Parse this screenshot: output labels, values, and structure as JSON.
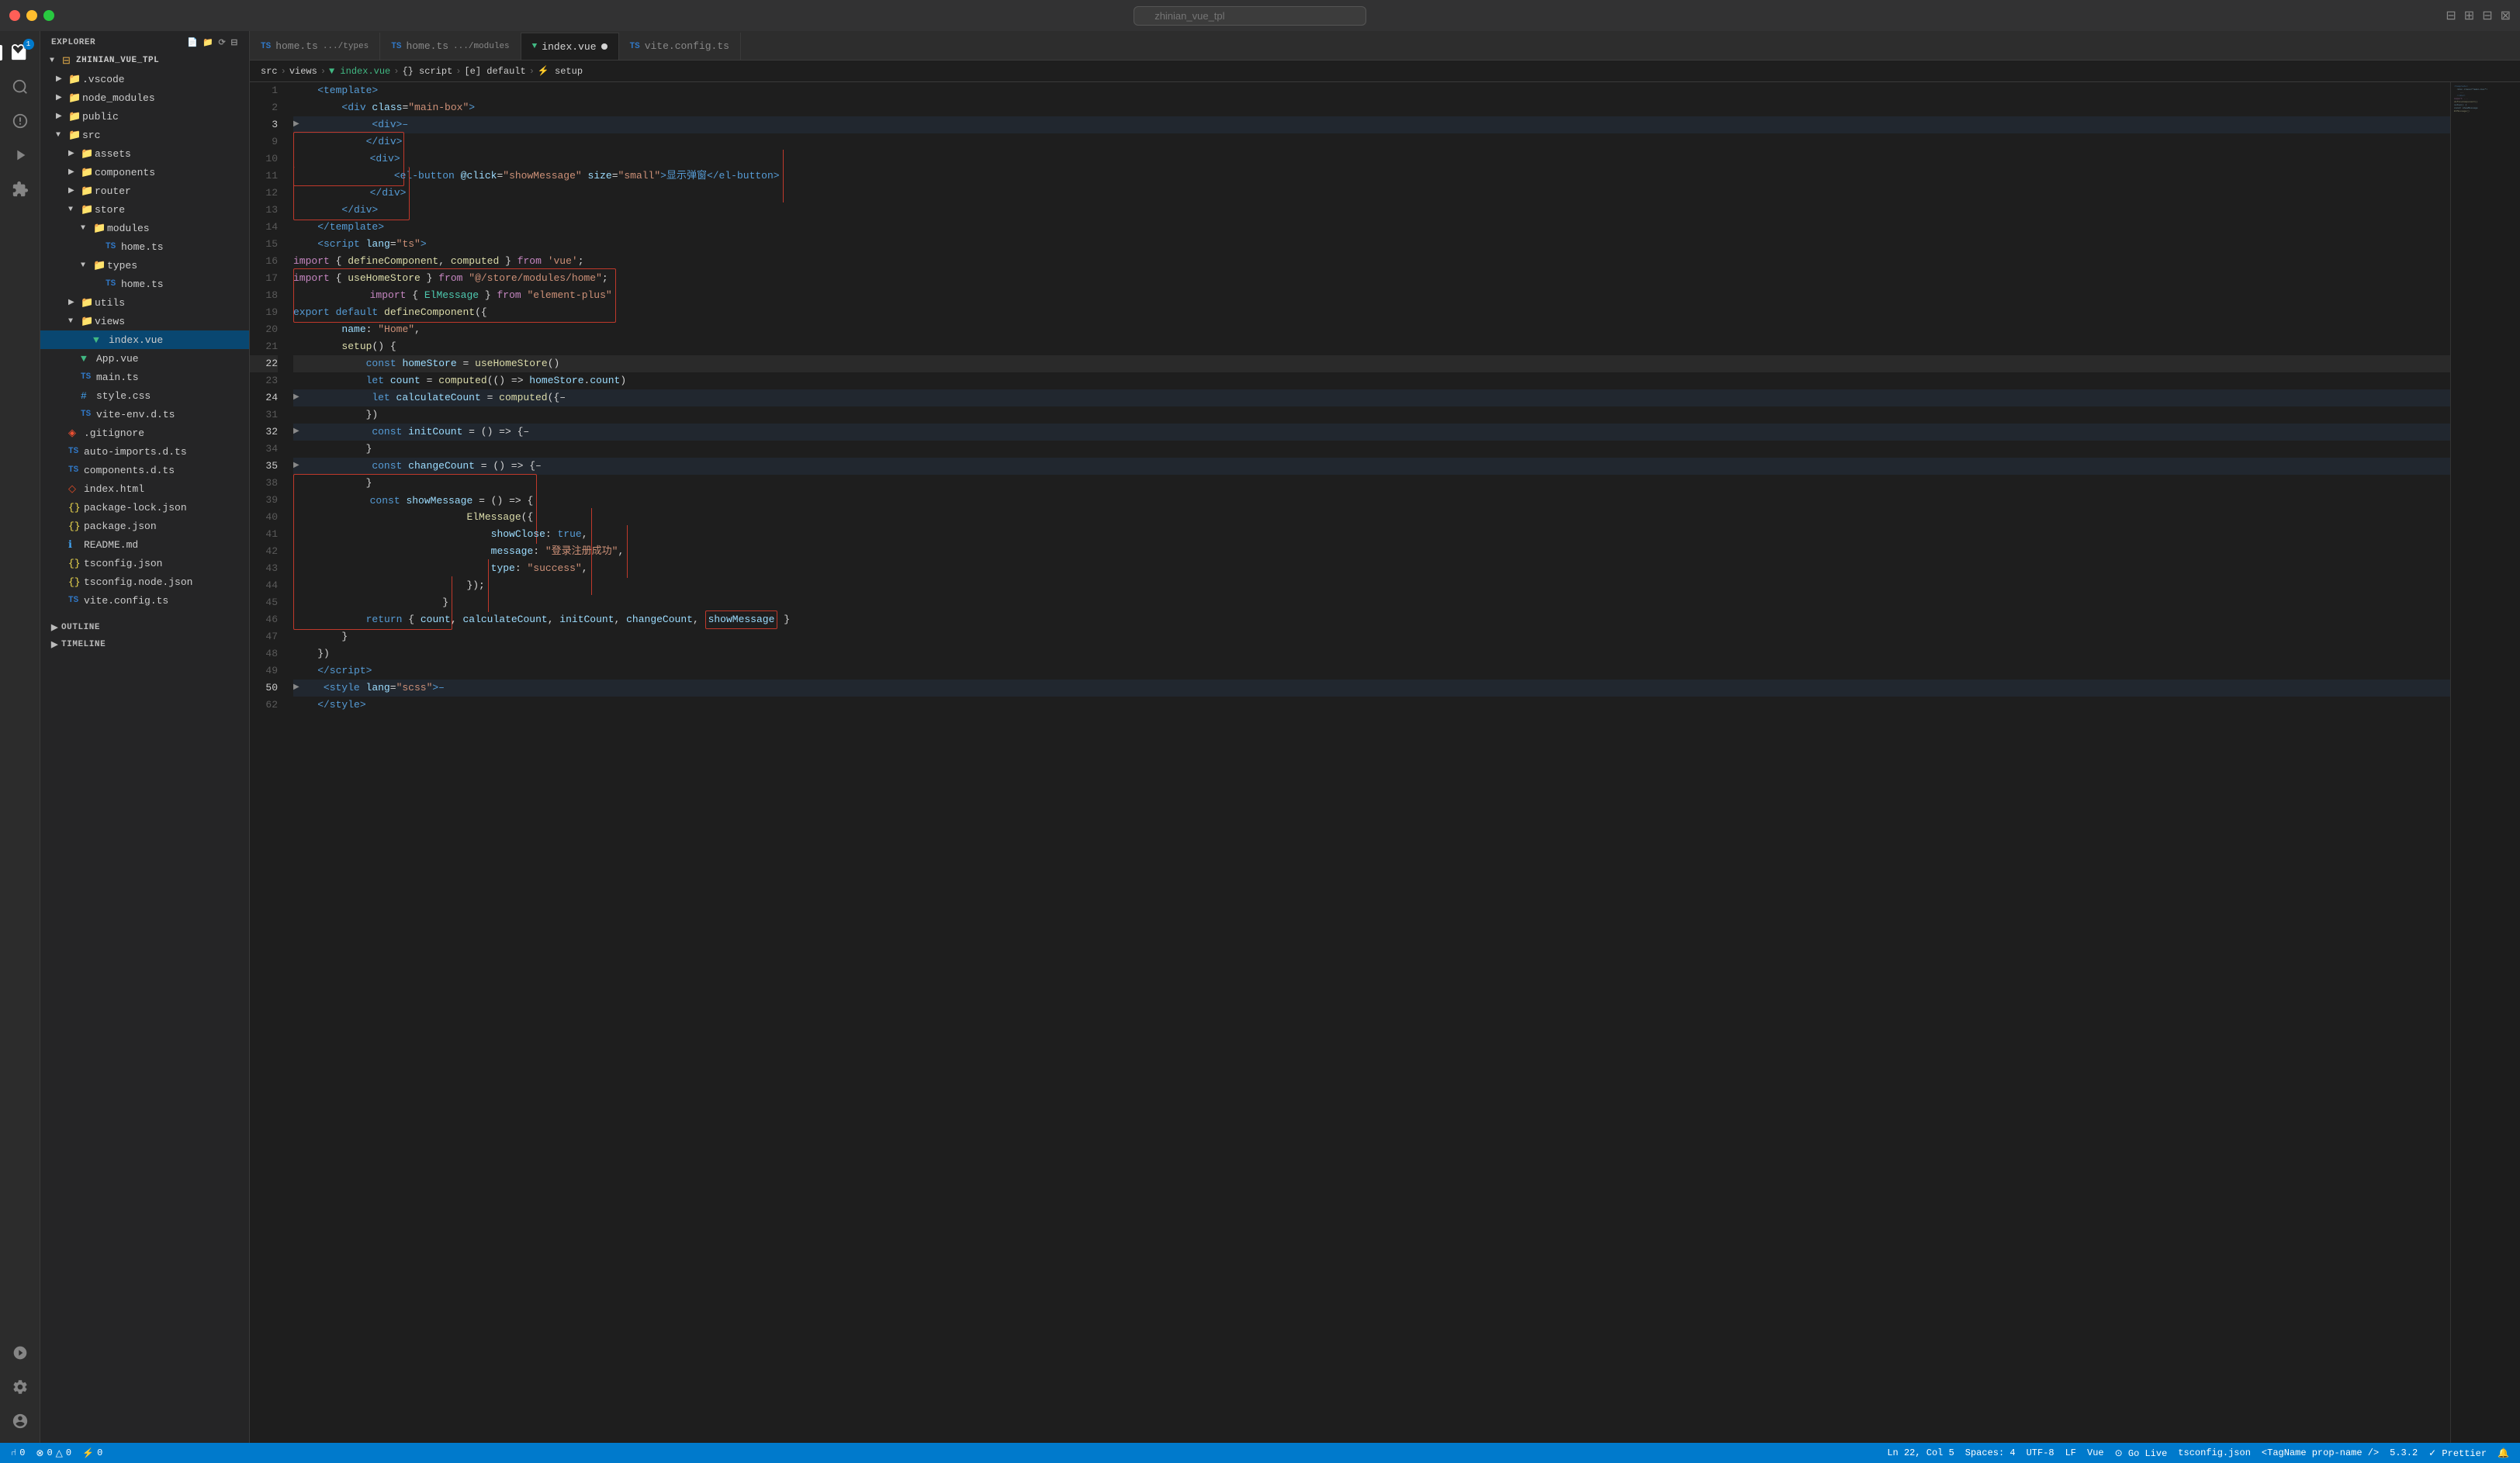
{
  "titleBar": {
    "searchPlaceholder": "zhinian_vue_tpl",
    "trafficLights": [
      "red",
      "yellow",
      "green"
    ]
  },
  "tabs": [
    {
      "id": "home-types",
      "prefix": "TS",
      "label": "home.ts",
      "sublabel": ".../types",
      "active": false,
      "modified": false,
      "type": "ts"
    },
    {
      "id": "home-modules",
      "prefix": "TS",
      "label": "home.ts",
      "sublabel": ".../modules",
      "active": false,
      "modified": false,
      "type": "ts"
    },
    {
      "id": "index-vue",
      "prefix": "V",
      "label": "index.vue",
      "sublabel": "",
      "active": true,
      "modified": true,
      "type": "vue"
    },
    {
      "id": "vite-config",
      "prefix": "TS",
      "label": "vite.config.ts",
      "sublabel": "",
      "active": false,
      "modified": false,
      "type": "ts"
    }
  ],
  "breadcrumb": {
    "parts": [
      "src",
      "views",
      "index.vue",
      "{} script",
      "[e] default",
      "setup"
    ]
  },
  "sidebar": {
    "header": "EXPLORER",
    "badge": "1",
    "root": "ZHINIAN_VUE_TPL",
    "items": [
      {
        "indent": 1,
        "icon": "folder",
        "label": ".vscode",
        "expanded": false,
        "type": "folder"
      },
      {
        "indent": 1,
        "icon": "folder",
        "label": "node_modules",
        "expanded": false,
        "type": "folder"
      },
      {
        "indent": 1,
        "icon": "folder",
        "label": "public",
        "expanded": false,
        "type": "folder"
      },
      {
        "indent": 1,
        "icon": "folder",
        "label": "src",
        "expanded": true,
        "type": "folder"
      },
      {
        "indent": 2,
        "icon": "folder",
        "label": "assets",
        "expanded": false,
        "type": "folder"
      },
      {
        "indent": 2,
        "icon": "folder",
        "label": "components",
        "expanded": false,
        "type": "folder"
      },
      {
        "indent": 2,
        "icon": "folder",
        "label": "router",
        "expanded": false,
        "type": "folder"
      },
      {
        "indent": 2,
        "icon": "folder",
        "label": "store",
        "expanded": true,
        "type": "folder"
      },
      {
        "indent": 3,
        "icon": "folder",
        "label": "modules",
        "expanded": true,
        "type": "folder"
      },
      {
        "indent": 4,
        "icon": "ts",
        "label": "home.ts",
        "expanded": false,
        "type": "ts"
      },
      {
        "indent": 3,
        "icon": "folder",
        "label": "types",
        "expanded": true,
        "type": "folder"
      },
      {
        "indent": 4,
        "icon": "ts",
        "label": "home.ts",
        "expanded": false,
        "type": "ts"
      },
      {
        "indent": 2,
        "icon": "folder",
        "label": "utils",
        "expanded": false,
        "type": "folder"
      },
      {
        "indent": 2,
        "icon": "folder",
        "label": "views",
        "expanded": true,
        "type": "folder"
      },
      {
        "indent": 3,
        "icon": "vue",
        "label": "index.vue",
        "expanded": false,
        "type": "vue",
        "active": true
      },
      {
        "indent": 2,
        "icon": "vue",
        "label": "App.vue",
        "expanded": false,
        "type": "vue"
      },
      {
        "indent": 2,
        "icon": "ts",
        "label": "main.ts",
        "expanded": false,
        "type": "ts"
      },
      {
        "indent": 2,
        "icon": "css",
        "label": "style.css",
        "expanded": false,
        "type": "css"
      },
      {
        "indent": 2,
        "icon": "ts",
        "label": "vite-env.d.ts",
        "expanded": false,
        "type": "ts"
      },
      {
        "indent": 1,
        "icon": "git",
        "label": ".gitignore",
        "expanded": false,
        "type": "git"
      },
      {
        "indent": 1,
        "icon": "ts",
        "label": "auto-imports.d.ts",
        "expanded": false,
        "type": "ts"
      },
      {
        "indent": 1,
        "icon": "ts",
        "label": "components.d.ts",
        "expanded": false,
        "type": "ts"
      },
      {
        "indent": 1,
        "icon": "html",
        "label": "index.html",
        "expanded": false,
        "type": "html"
      },
      {
        "indent": 1,
        "icon": "json",
        "label": "package-lock.json",
        "expanded": false,
        "type": "json"
      },
      {
        "indent": 1,
        "icon": "json",
        "label": "package.json",
        "expanded": false,
        "type": "json"
      },
      {
        "indent": 1,
        "icon": "md",
        "label": "README.md",
        "expanded": false,
        "type": "md"
      },
      {
        "indent": 1,
        "icon": "json",
        "label": "tsconfig.json",
        "expanded": false,
        "type": "json"
      },
      {
        "indent": 1,
        "icon": "json",
        "label": "tsconfig.node.json",
        "expanded": false,
        "type": "json"
      },
      {
        "indent": 1,
        "icon": "ts",
        "label": "vite.config.ts",
        "expanded": false,
        "type": "ts"
      }
    ]
  },
  "statusBar": {
    "left": {
      "branch": "0",
      "warnings": "0 △ 0",
      "errors": "⚡ 0"
    },
    "right": {
      "position": "Ln 22, Col 5",
      "spaces": "Spaces: 4",
      "encoding": "UTF-8",
      "lineEnding": "LF",
      "language": "Vue",
      "golive": "⊙ Go Live",
      "tsconfig": "tsconfig.json",
      "tagname": "<TagName prop-name />",
      "version": "5.3.2",
      "prettier": "✓ Prettier"
    }
  },
  "outline": {
    "label": "OUTLINE"
  },
  "timeline": {
    "label": "TIMELINE"
  }
}
